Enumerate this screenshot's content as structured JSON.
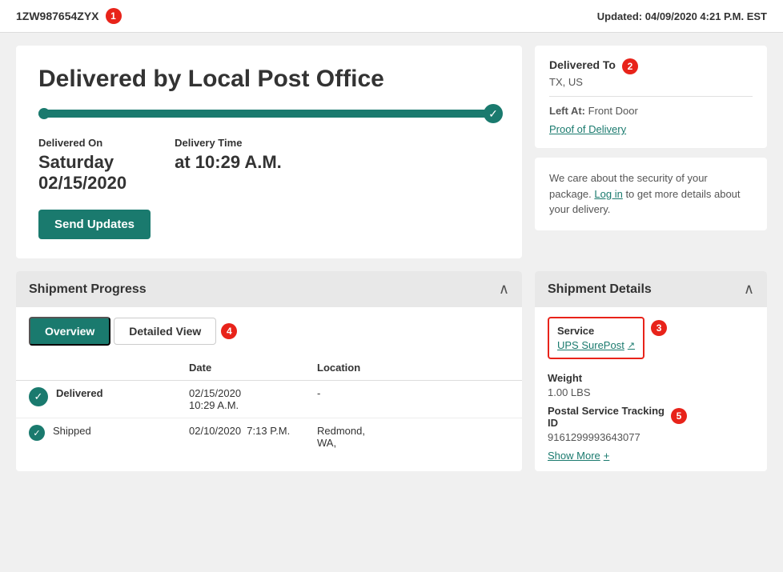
{
  "topbar": {
    "tracking_number": "1ZW987654ZYX",
    "badge1": "1",
    "updated_label": "Updated:",
    "updated_value": "04/09/2020 4:21 P.M. EST"
  },
  "delivery_card": {
    "title": "Delivered by Local Post Office",
    "delivered_on_label": "Delivered On",
    "delivered_date": "Saturday\n02/15/2020",
    "delivery_time_label": "Delivery Time",
    "delivery_time": "at 10:29 A.M.",
    "send_updates_label": "Send Updates"
  },
  "right_cards": {
    "delivered_to_title": "Delivered To",
    "delivered_to_value": "TX, US",
    "badge2": "2",
    "left_at_label": "Left At:",
    "left_at_value": "Front Door",
    "proof_link": "Proof of Delivery",
    "security_text_1": "We care about the security of your package.",
    "login_link": "Log in",
    "security_text_2": "to get more details about your delivery."
  },
  "shipment_progress": {
    "title": "Shipment Progress",
    "tab_overview": "Overview",
    "tab_detailed": "Detailed View",
    "badge4": "4",
    "col_status": "",
    "col_date": "Date",
    "col_location": "Location",
    "rows": [
      {
        "status": "Delivered",
        "bold": true,
        "date": "02/15/2020\n10:29 A.M.",
        "location": "-",
        "icon": "check"
      },
      {
        "status": "Shipped",
        "bold": false,
        "date": "02/10/2020  7:13 P.M.",
        "location": "Redmond,\nWA,",
        "icon": "check"
      }
    ]
  },
  "shipment_details": {
    "title": "Shipment Details",
    "service_label": "Service",
    "service_value": "UPS SurePost",
    "service_external_icon": "↗",
    "badge3": "3",
    "weight_label": "Weight",
    "weight_value": "1.00 LBS",
    "postal_label": "Postal Service Tracking\nID",
    "postal_value": "9161299993643077",
    "badge5": "5",
    "show_more_label": "Show More",
    "show_more_icon": "+"
  }
}
